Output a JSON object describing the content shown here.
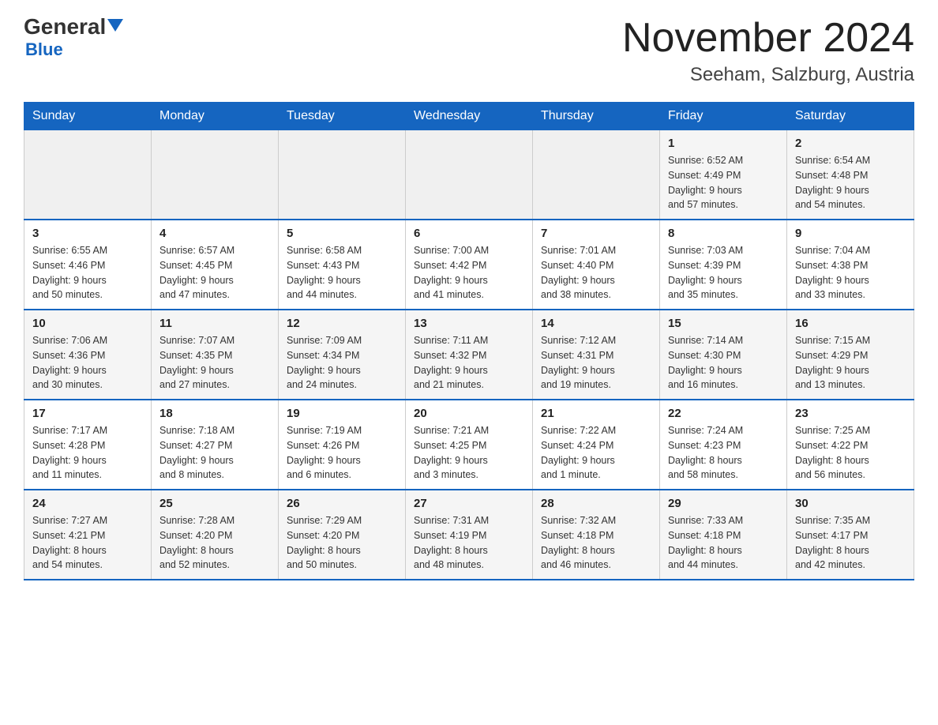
{
  "header": {
    "logo_general": "General",
    "logo_blue": "Blue",
    "month_title": "November 2024",
    "location": "Seeham, Salzburg, Austria"
  },
  "weekdays": [
    "Sunday",
    "Monday",
    "Tuesday",
    "Wednesday",
    "Thursday",
    "Friday",
    "Saturday"
  ],
  "rows": [
    {
      "cells": [
        {
          "day": "",
          "info": ""
        },
        {
          "day": "",
          "info": ""
        },
        {
          "day": "",
          "info": ""
        },
        {
          "day": "",
          "info": ""
        },
        {
          "day": "",
          "info": ""
        },
        {
          "day": "1",
          "info": "Sunrise: 6:52 AM\nSunset: 4:49 PM\nDaylight: 9 hours\nand 57 minutes."
        },
        {
          "day": "2",
          "info": "Sunrise: 6:54 AM\nSunset: 4:48 PM\nDaylight: 9 hours\nand 54 minutes."
        }
      ]
    },
    {
      "cells": [
        {
          "day": "3",
          "info": "Sunrise: 6:55 AM\nSunset: 4:46 PM\nDaylight: 9 hours\nand 50 minutes."
        },
        {
          "day": "4",
          "info": "Sunrise: 6:57 AM\nSunset: 4:45 PM\nDaylight: 9 hours\nand 47 minutes."
        },
        {
          "day": "5",
          "info": "Sunrise: 6:58 AM\nSunset: 4:43 PM\nDaylight: 9 hours\nand 44 minutes."
        },
        {
          "day": "6",
          "info": "Sunrise: 7:00 AM\nSunset: 4:42 PM\nDaylight: 9 hours\nand 41 minutes."
        },
        {
          "day": "7",
          "info": "Sunrise: 7:01 AM\nSunset: 4:40 PM\nDaylight: 9 hours\nand 38 minutes."
        },
        {
          "day": "8",
          "info": "Sunrise: 7:03 AM\nSunset: 4:39 PM\nDaylight: 9 hours\nand 35 minutes."
        },
        {
          "day": "9",
          "info": "Sunrise: 7:04 AM\nSunset: 4:38 PM\nDaylight: 9 hours\nand 33 minutes."
        }
      ]
    },
    {
      "cells": [
        {
          "day": "10",
          "info": "Sunrise: 7:06 AM\nSunset: 4:36 PM\nDaylight: 9 hours\nand 30 minutes."
        },
        {
          "day": "11",
          "info": "Sunrise: 7:07 AM\nSunset: 4:35 PM\nDaylight: 9 hours\nand 27 minutes."
        },
        {
          "day": "12",
          "info": "Sunrise: 7:09 AM\nSunset: 4:34 PM\nDaylight: 9 hours\nand 24 minutes."
        },
        {
          "day": "13",
          "info": "Sunrise: 7:11 AM\nSunset: 4:32 PM\nDaylight: 9 hours\nand 21 minutes."
        },
        {
          "day": "14",
          "info": "Sunrise: 7:12 AM\nSunset: 4:31 PM\nDaylight: 9 hours\nand 19 minutes."
        },
        {
          "day": "15",
          "info": "Sunrise: 7:14 AM\nSunset: 4:30 PM\nDaylight: 9 hours\nand 16 minutes."
        },
        {
          "day": "16",
          "info": "Sunrise: 7:15 AM\nSunset: 4:29 PM\nDaylight: 9 hours\nand 13 minutes."
        }
      ]
    },
    {
      "cells": [
        {
          "day": "17",
          "info": "Sunrise: 7:17 AM\nSunset: 4:28 PM\nDaylight: 9 hours\nand 11 minutes."
        },
        {
          "day": "18",
          "info": "Sunrise: 7:18 AM\nSunset: 4:27 PM\nDaylight: 9 hours\nand 8 minutes."
        },
        {
          "day": "19",
          "info": "Sunrise: 7:19 AM\nSunset: 4:26 PM\nDaylight: 9 hours\nand 6 minutes."
        },
        {
          "day": "20",
          "info": "Sunrise: 7:21 AM\nSunset: 4:25 PM\nDaylight: 9 hours\nand 3 minutes."
        },
        {
          "day": "21",
          "info": "Sunrise: 7:22 AM\nSunset: 4:24 PM\nDaylight: 9 hours\nand 1 minute."
        },
        {
          "day": "22",
          "info": "Sunrise: 7:24 AM\nSunset: 4:23 PM\nDaylight: 8 hours\nand 58 minutes."
        },
        {
          "day": "23",
          "info": "Sunrise: 7:25 AM\nSunset: 4:22 PM\nDaylight: 8 hours\nand 56 minutes."
        }
      ]
    },
    {
      "cells": [
        {
          "day": "24",
          "info": "Sunrise: 7:27 AM\nSunset: 4:21 PM\nDaylight: 8 hours\nand 54 minutes."
        },
        {
          "day": "25",
          "info": "Sunrise: 7:28 AM\nSunset: 4:20 PM\nDaylight: 8 hours\nand 52 minutes."
        },
        {
          "day": "26",
          "info": "Sunrise: 7:29 AM\nSunset: 4:20 PM\nDaylight: 8 hours\nand 50 minutes."
        },
        {
          "day": "27",
          "info": "Sunrise: 7:31 AM\nSunset: 4:19 PM\nDaylight: 8 hours\nand 48 minutes."
        },
        {
          "day": "28",
          "info": "Sunrise: 7:32 AM\nSunset: 4:18 PM\nDaylight: 8 hours\nand 46 minutes."
        },
        {
          "day": "29",
          "info": "Sunrise: 7:33 AM\nSunset: 4:18 PM\nDaylight: 8 hours\nand 44 minutes."
        },
        {
          "day": "30",
          "info": "Sunrise: 7:35 AM\nSunset: 4:17 PM\nDaylight: 8 hours\nand 42 minutes."
        }
      ]
    }
  ]
}
